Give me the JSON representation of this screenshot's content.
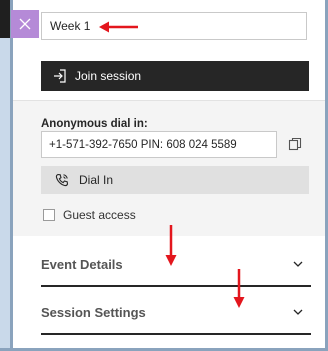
{
  "session": {
    "title_value": "Week 1",
    "join_label": "Join session"
  },
  "dial_in": {
    "label": "Anonymous dial in:",
    "number": "+1-571-392-7650 PIN: 608 024 5589",
    "dial_button_label": "Dial In"
  },
  "guest_access": {
    "label": "Guest access",
    "checked": false
  },
  "sections": {
    "event_details": "Event Details",
    "session_settings": "Session Settings"
  },
  "colors": {
    "close_button_bg": "#b58ad7",
    "join_button_bg": "#262626",
    "annotation_arrow": "#e3161d"
  },
  "icons": {
    "close": "close-icon",
    "join": "login-icon",
    "copy": "copy-icon",
    "dial": "phone-icon",
    "expand": "chevron-down-icon"
  }
}
